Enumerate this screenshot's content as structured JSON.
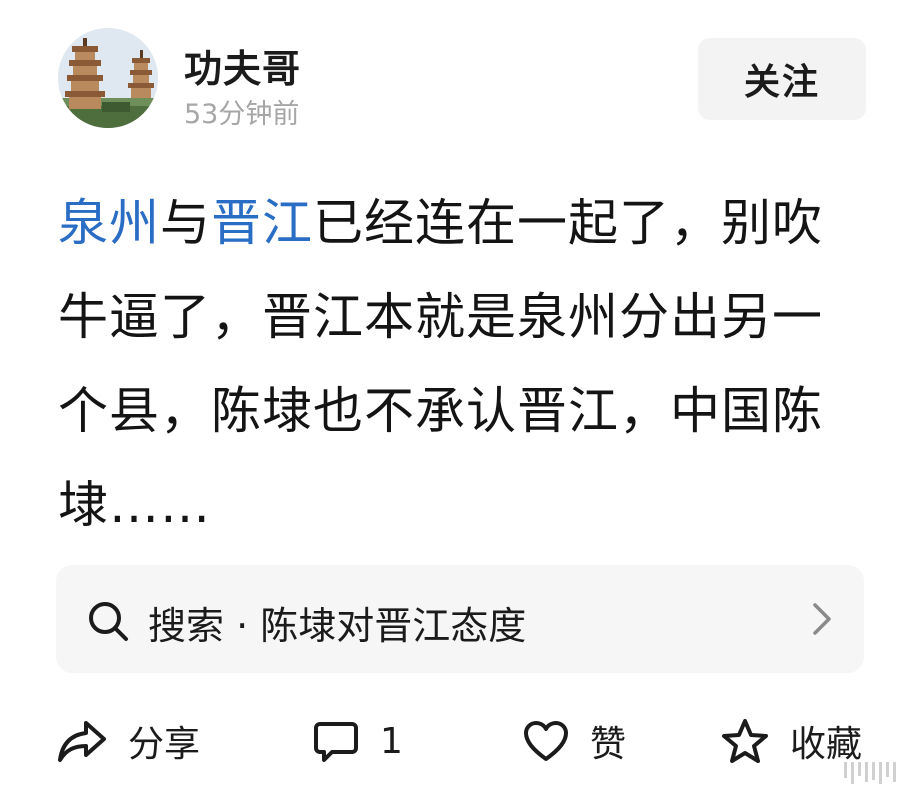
{
  "header": {
    "username": "功夫哥",
    "timestamp": "53分钟前",
    "follow_label": "关注"
  },
  "post": {
    "segments": [
      {
        "text": "泉州",
        "type": "link"
      },
      {
        "text": "与",
        "type": "text"
      },
      {
        "text": "晋江",
        "type": "link"
      },
      {
        "text": "已经连在一起了，别吹牛逼了，晋江本就是泉州分出另一个县，陈埭也不承认晋江，中国陈埭……",
        "type": "text"
      }
    ],
    "link_color": "#2a6dc4"
  },
  "search": {
    "label": "搜索 · 陈埭对晋江态度",
    "icon": "search-icon",
    "chevron": "chevron-right-icon"
  },
  "actions": {
    "share_label": "分享",
    "comment_count": "1",
    "like_label": "赞",
    "collect_label": "收藏"
  }
}
